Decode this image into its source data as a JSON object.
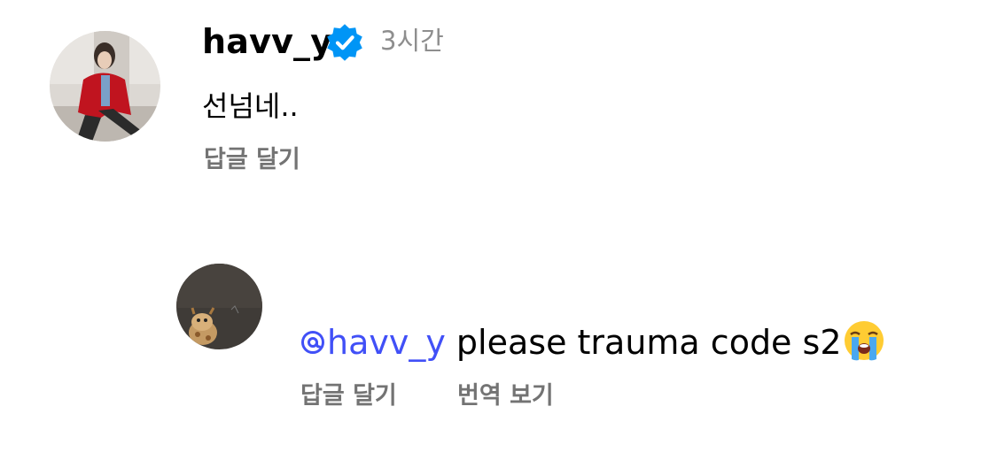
{
  "comment": {
    "username": "havv_y",
    "verified_icon": "verified-badge-icon",
    "timestamp": "3시간",
    "text": "선넘네..",
    "reply_label": "답글 달기"
  },
  "reply": {
    "mention": "havv_y",
    "mention_icon": "threads-at-icon",
    "text": " please trauma code s2",
    "emoji": "loudly-crying-face-emoji",
    "reply_label": "답글 달기",
    "translate_label": "번역 보기"
  },
  "colors": {
    "mention": "#4150f7",
    "verified": "#0095f6",
    "secondary_text": "#737373",
    "timestamp": "#8e8e8e"
  }
}
